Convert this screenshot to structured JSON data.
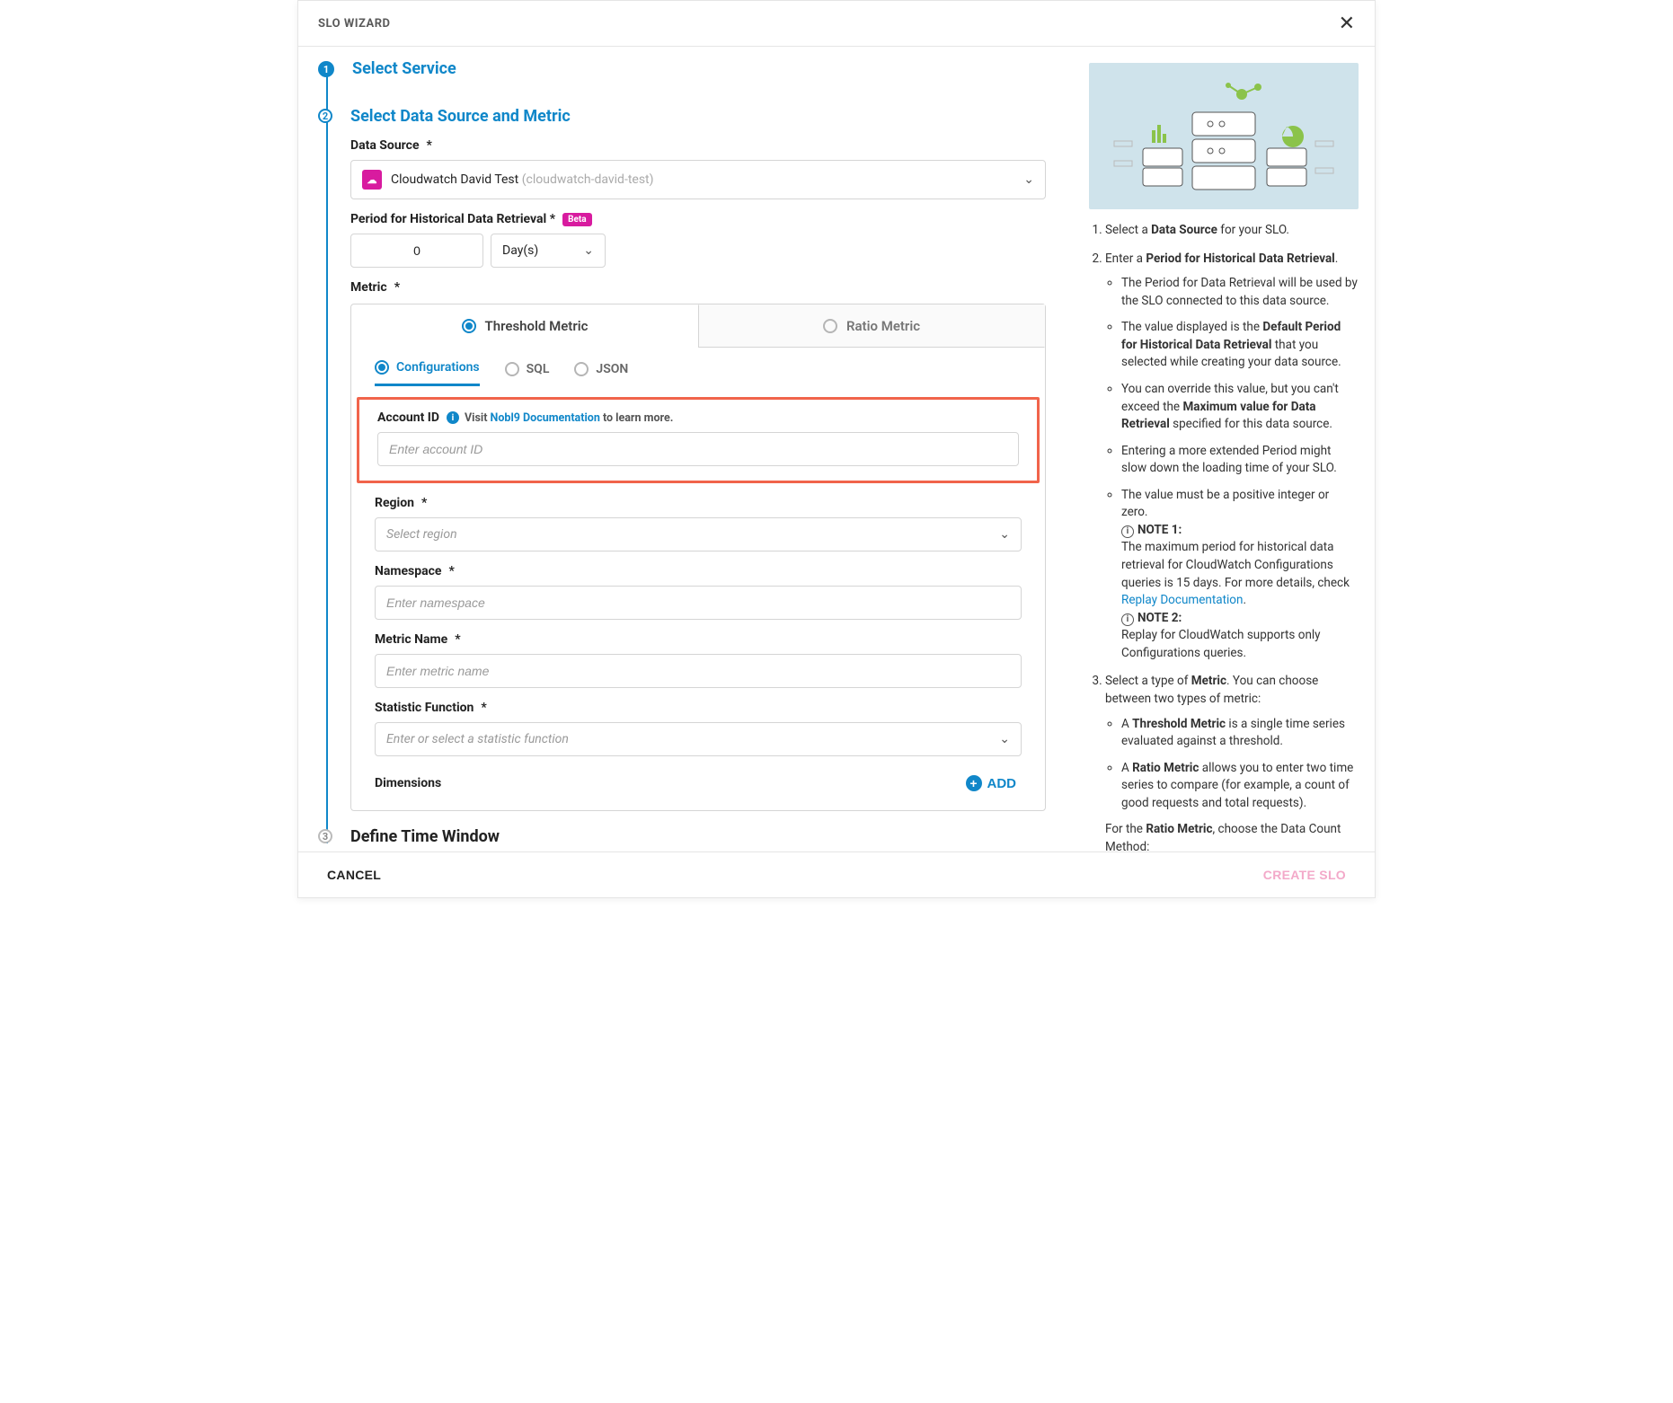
{
  "modal": {
    "title": "SLO WIZARD"
  },
  "steps": {
    "s1": "Select Service",
    "s2": "Select Data Source and Metric",
    "s3": "Define Time Window"
  },
  "dataSource": {
    "label": "Data Source",
    "valueName": "Cloudwatch David Test",
    "valueSlug": "(cloudwatch-david-test)"
  },
  "period": {
    "label": "Period for Historical Data Retrieval",
    "badge": "Beta",
    "value": "0",
    "unit": "Day(s)"
  },
  "metric": {
    "label": "Metric",
    "tabThreshold": "Threshold Metric",
    "tabRatio": "Ratio Metric",
    "subConfigurations": "Configurations",
    "subSQL": "SQL",
    "subJSON": "JSON"
  },
  "accountId": {
    "label": "Account ID",
    "helpPrefix": "Visit ",
    "helpLink": "Nobl9 Documentation",
    "helpSuffix": " to learn more.",
    "placeholder": "Enter account ID"
  },
  "region": {
    "label": "Region",
    "placeholder": "Select region"
  },
  "namespace": {
    "label": "Namespace",
    "placeholder": "Enter namespace"
  },
  "metricName": {
    "label": "Metric Name",
    "placeholder": "Enter metric name"
  },
  "statFn": {
    "label": "Statistic Function",
    "placeholder": "Enter or select a statistic function"
  },
  "dimensions": {
    "label": "Dimensions",
    "add": "ADD"
  },
  "footer": {
    "cancel": "CANCEL",
    "create": "CREATE SLO"
  },
  "help": {
    "li1a": "Select a ",
    "li1b": "Data Source",
    "li1c": " for your SLO.",
    "li2a": "Enter a ",
    "li2b": "Period for Historical Data Retrieval",
    "li2c": ".",
    "s1": "The Period for Data Retrieval will be used by the SLO connected to this data source.",
    "s2a": "The value displayed is the ",
    "s2b": "Default Period for Historical Data Retrieval",
    "s2c": " that you selected while creating your data source.",
    "s3a": "You can override this value, but you can't exceed the ",
    "s3b": "Maximum value for Data Retrieval",
    "s3c": " specified for this data source.",
    "s4": "Entering a more extended Period might slow down the loading time of your SLO.",
    "s5": "The value must be a positive integer or zero.",
    "note1l": "NOTE 1:",
    "note1a": "The maximum period for historical data retrieval for CloudWatch Configurations queries is 15 days. For more details, check ",
    "note1link": "Replay Documentation",
    "note1b": ".",
    "note2l": "NOTE 2:",
    "note2": "Replay for CloudWatch supports only Configurations queries.",
    "li3a": "Select a type of ",
    "li3b": "Metric",
    "li3c": ". You can choose between two types of metric:",
    "t1a": "A ",
    "t1b": "Threshold Metric",
    "t1c": " is a single time series evaluated against a threshold.",
    "t2a": "A ",
    "t2b": "Ratio Metric",
    "t2c": " allows you to enter two time series to compare (for example, a count of good requests and total requests).",
    "t3a": "For the ",
    "t3b": "Ratio Metric",
    "t3c": ", choose the Data Count Method:"
  }
}
